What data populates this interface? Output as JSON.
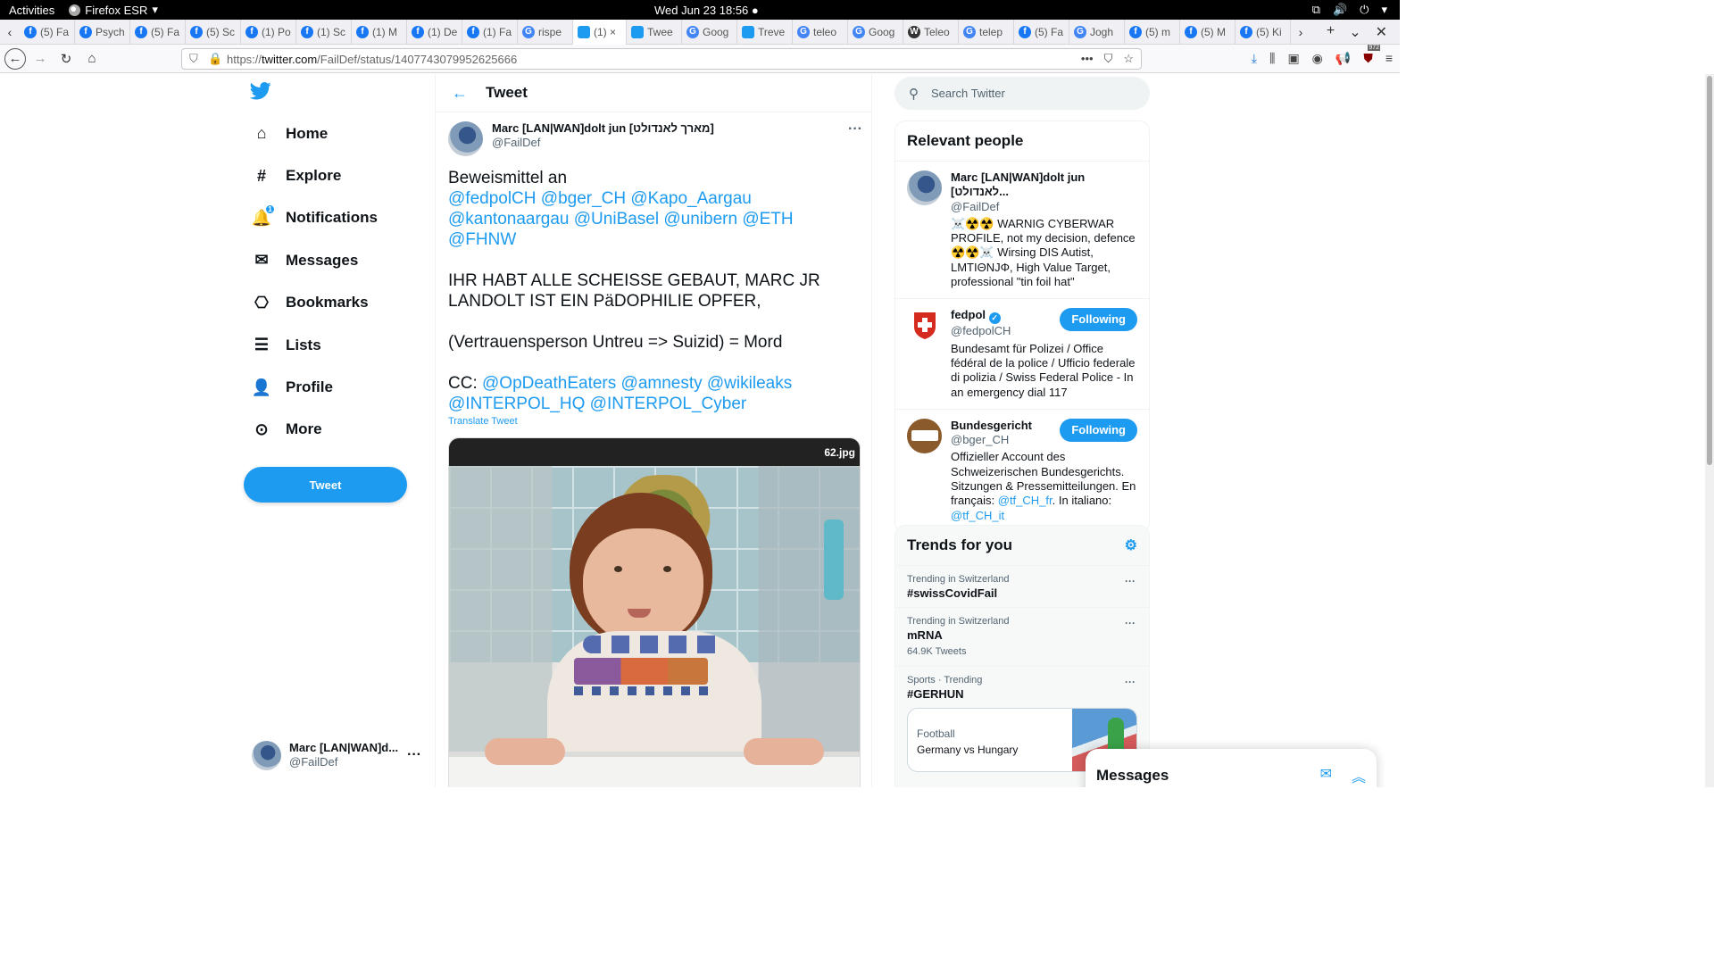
{
  "system": {
    "activities": "Activities",
    "app_name": "Firefox ESR",
    "clock": "Wed Jun 23  18:56 ●"
  },
  "tabs": [
    {
      "label": "(5) Fa",
      "icon": "facebook",
      "color": "#1877f2"
    },
    {
      "label": "Psych",
      "icon": "facebook",
      "color": "#1877f2"
    },
    {
      "label": "(5) Fa",
      "icon": "facebook",
      "color": "#1877f2"
    },
    {
      "label": "(5) Sc",
      "icon": "facebook",
      "color": "#1877f2"
    },
    {
      "label": "(1) Po",
      "icon": "facebook",
      "color": "#1877f2"
    },
    {
      "label": "(1) Sc",
      "icon": "facebook",
      "color": "#1877f2"
    },
    {
      "label": "(1) M",
      "icon": "facebook",
      "color": "#1877f2"
    },
    {
      "label": "(1) De",
      "icon": "facebook",
      "color": "#1877f2"
    },
    {
      "label": "(1) Fa",
      "icon": "facebook",
      "color": "#1877f2"
    },
    {
      "label": "rispe",
      "icon": "google",
      "color": "#4285f4"
    },
    {
      "label": "(1) ×",
      "icon": "twitter",
      "color": "#1d9bf0"
    },
    {
      "label": "Twee",
      "icon": "twitter",
      "color": "#1d9bf0"
    },
    {
      "label": "Goog",
      "icon": "translate",
      "color": "#4285f4"
    },
    {
      "label": "Treve",
      "icon": "twitter",
      "color": "#1d9bf0"
    },
    {
      "label": "teleo",
      "icon": "google",
      "color": "#4285f4"
    },
    {
      "label": "Goog",
      "icon": "translate",
      "color": "#4285f4"
    },
    {
      "label": "Teleo",
      "icon": "wiki",
      "color": "#333"
    },
    {
      "label": "telep",
      "icon": "google",
      "color": "#4285f4"
    },
    {
      "label": "(5) Fa",
      "icon": "facebook",
      "color": "#1877f2"
    },
    {
      "label": "Jogh",
      "icon": "google",
      "color": "#4285f4"
    },
    {
      "label": "(5) m",
      "icon": "facebook",
      "color": "#1877f2"
    },
    {
      "label": "(5) M",
      "icon": "facebook",
      "color": "#1877f2"
    },
    {
      "label": "(5) Ki",
      "icon": "facebook",
      "color": "#1877f2"
    }
  ],
  "url": {
    "prefix": "https://",
    "host": "twitter.com",
    "path": "/FailDef/status/1407743079952625666"
  },
  "toolbar": {
    "badge_count": "972"
  },
  "nav": {
    "items": [
      {
        "label": "Home",
        "icon": "⌂"
      },
      {
        "label": "Explore",
        "icon": "#"
      },
      {
        "label": "Notifications",
        "icon": "🔔"
      },
      {
        "label": "Messages",
        "icon": "✉"
      },
      {
        "label": "Bookmarks",
        "icon": "🔖"
      },
      {
        "label": "Lists",
        "icon": "☰"
      },
      {
        "label": "Profile",
        "icon": "👤"
      },
      {
        "label": "More",
        "icon": "⋯"
      }
    ],
    "notif_badge": "1",
    "tweet_button": "Tweet"
  },
  "account": {
    "name": "Marc [LAN|WAN]d...",
    "handle": "@FailDef"
  },
  "tweet": {
    "header": "Tweet",
    "author_name": "Marc [LAN|WAN]dolt jun [מארך לאנדולט]",
    "author_handle": "@FailDef",
    "line1": "Beweismittel an",
    "mentions1": "@fedpolCH @bger_CH @Kapo_Aargau @kantonaargau @UniBasel @unibern @ETH @FHNW",
    "line2": "IHR HABT ALLE SCHEISSE GEBAUT, MARC JR LANDOLT IST EIN PäDOPHILIE OPFER,",
    "line3": "(Vertrauensperson Untreu => Suizid) = Mord",
    "cc_label": "CC: ",
    "mentions2": "@OpDeathEaters @amnesty @wikileaks @INTERPOL_HQ @INTERPOL_Cyber",
    "translate": "Translate Tweet",
    "media_label": "62.jpg"
  },
  "search": {
    "placeholder": "Search Twitter"
  },
  "relevant": {
    "title": "Relevant people",
    "people": [
      {
        "name": "Marc [LAN|WAN]dolt jun [לאנדולט...",
        "handle": "@FailDef",
        "bio": "☠️☢️☢️ WARNIG CYBERWAR PROFILE, not my decision, defence ☢️☢️☠️ Wirsing DIS Autist, LMTIΘNJΦ, High Value Target, professional \"tin foil hat\""
      },
      {
        "name": "fedpol",
        "handle": "@fedpolCH",
        "button": "Following",
        "bio": "Bundesamt für Polizei / Office fédéral de la police / Ufficio federale di polizia / Swiss Federal Police - In an emergency dial 117"
      },
      {
        "name": "Bundesgericht",
        "handle": "@bger_CH",
        "button": "Following",
        "bio_pre": "Offizieller Account des Schweizerischen Bundesgerichts. Sitzungen & Pressemitteilungen. En français: ",
        "link1": "@tf_CH_fr",
        "bio_mid": ". In italiano: ",
        "link2": "@tf_CH_it"
      }
    ]
  },
  "trends": {
    "title": "Trends for you",
    "items": [
      {
        "context": "Trending in Switzerland",
        "name": "#swissCovidFail",
        "count": ""
      },
      {
        "context": "Trending in Switzerland",
        "name": "mRNA",
        "count": "64.9K Tweets"
      },
      {
        "context": "Sports · Trending",
        "name": "#GERHUN",
        "count": ""
      }
    ],
    "card": {
      "category": "Football",
      "match": "Germany vs Hungary"
    }
  },
  "messages_dock": {
    "title": "Messages"
  }
}
